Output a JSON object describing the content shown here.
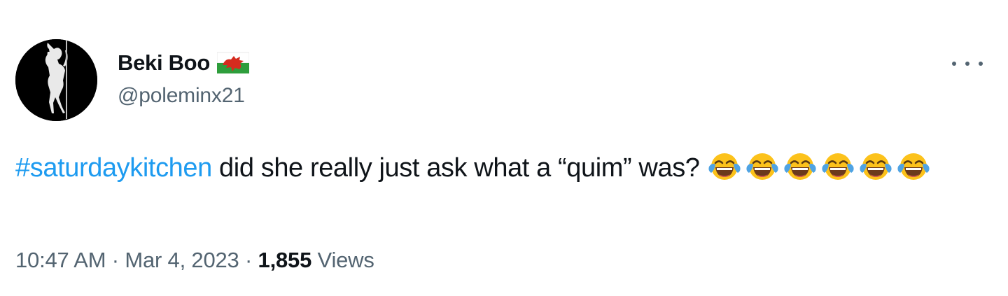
{
  "author": {
    "display_name": "Beki Boo",
    "handle": "@poleminx21",
    "flag_icon": "wales-flag-icon"
  },
  "tweet": {
    "hashtag": "#saturdaykitchen",
    "text": " did she really just ask what a “quim” was? ",
    "emoji_icon": "face-with-tears-of-joy-icon",
    "emoji_count": 6
  },
  "meta": {
    "time": "10:47 AM",
    "separator": " · ",
    "date": "Mar 4, 2023",
    "views_count": "1,855",
    "views_label": " Views"
  },
  "colors": {
    "link": "#1d9bf0",
    "secondary_text": "#536471",
    "primary_text": "#0f1419"
  }
}
